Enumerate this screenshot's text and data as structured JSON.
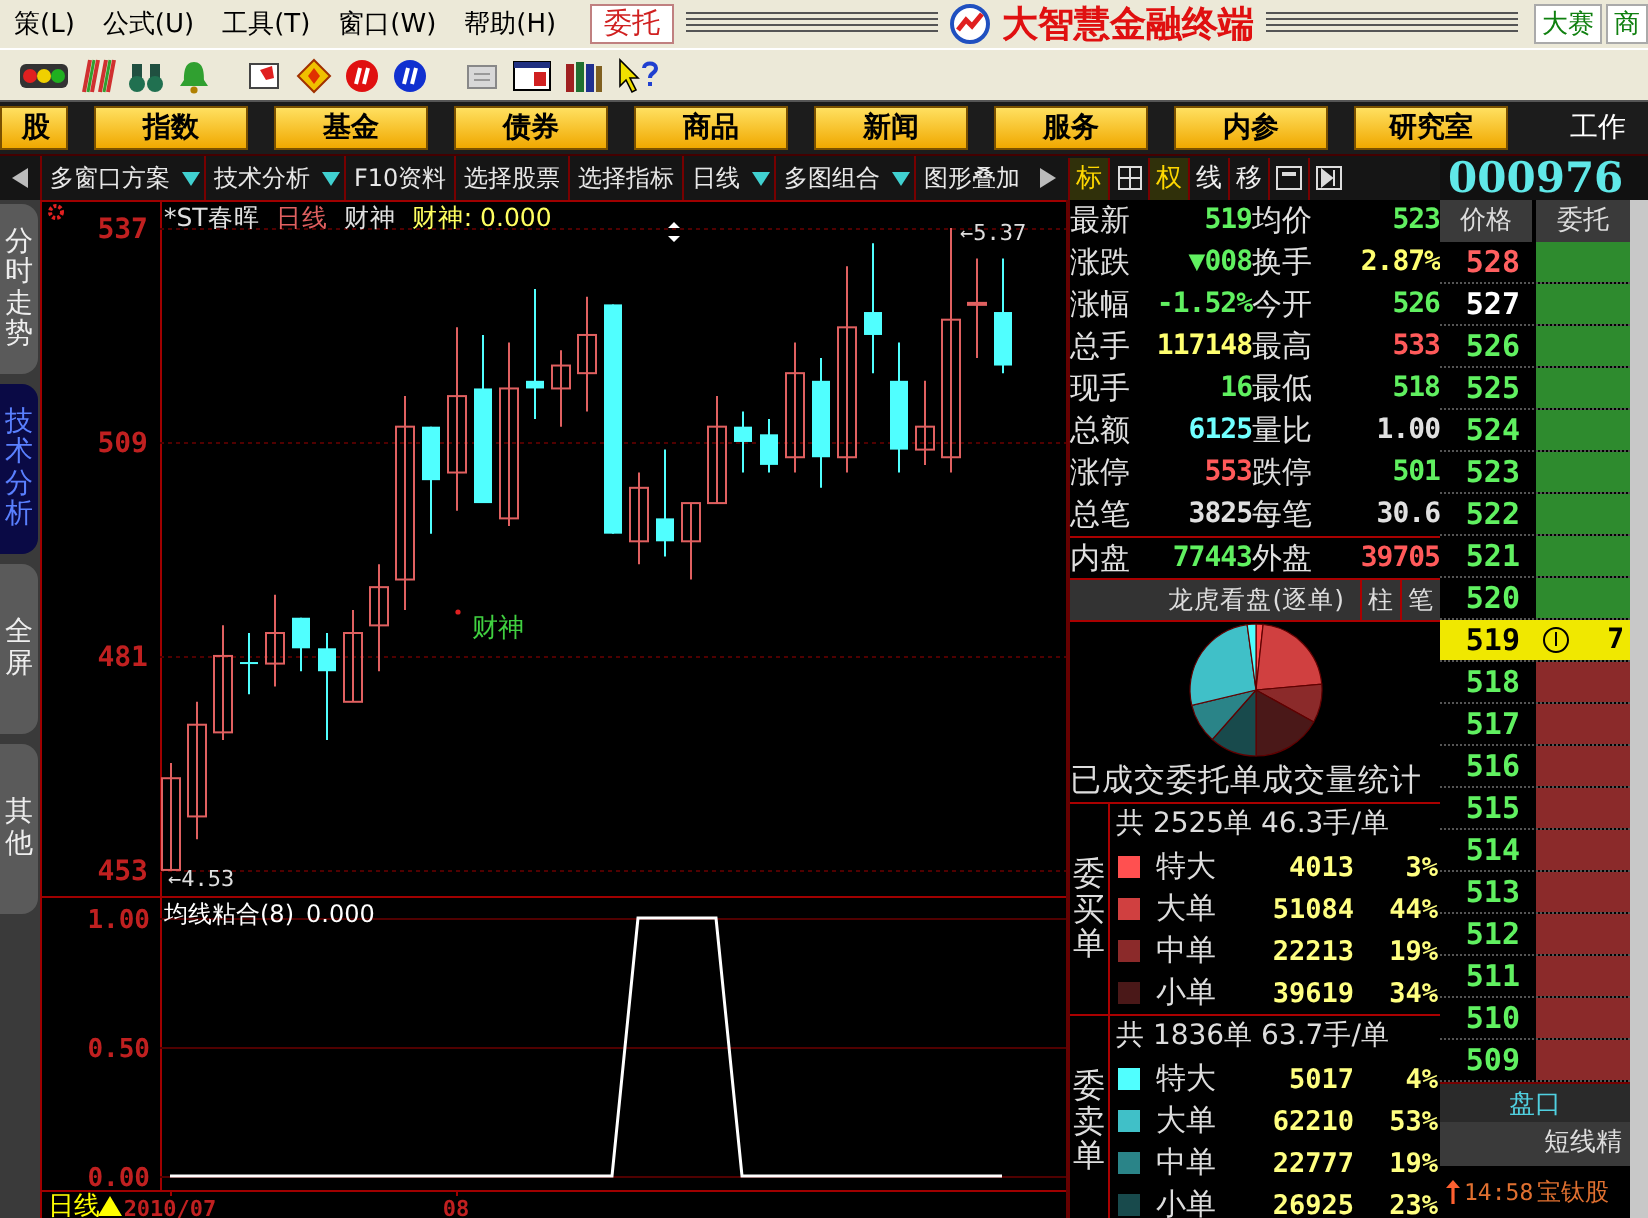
{
  "menu_bar": {
    "items": [
      "策(L)",
      "公式(U)",
      "工具(T)",
      "窗口(W)",
      "帮助(H)"
    ],
    "order_button": "委托",
    "title": "大智慧金融终端",
    "right_tabs": [
      "大赛",
      "商"
    ]
  },
  "nav_bar": {
    "buttons": [
      "股",
      "指数",
      "基金",
      "债券",
      "商品",
      "新闻",
      "服务",
      "内参",
      "研究室"
    ],
    "extra": "工作"
  },
  "tab_bar": {
    "items": [
      {
        "label": "多窗口方案",
        "dropdown": true
      },
      {
        "label": "技术分析",
        "dropdown": true
      },
      {
        "label": "F10资料",
        "dropdown": false
      },
      {
        "label": "选择股票",
        "dropdown": false
      },
      {
        "label": "选择指标",
        "dropdown": false
      },
      {
        "label": "日线",
        "dropdown": true
      },
      {
        "label": "多图组合",
        "dropdown": true
      },
      {
        "label": "图形叠加",
        "dropdown": false
      }
    ],
    "right_buttons": [
      {
        "kind": "text",
        "label": "标",
        "selected": true
      },
      {
        "kind": "grid",
        "selected": false
      },
      {
        "kind": "text",
        "label": "权",
        "selected": true
      },
      {
        "kind": "text",
        "label": "线",
        "selected": false
      },
      {
        "kind": "text",
        "label": "移",
        "selected": false
      },
      {
        "kind": "window",
        "selected": false
      },
      {
        "kind": "next",
        "selected": false
      }
    ],
    "stock_code": "000976"
  },
  "side_tabs": [
    {
      "label": "分时走势",
      "selected": false
    },
    {
      "label": "技术分析",
      "selected": true
    },
    {
      "label": "全屏",
      "selected": false
    },
    {
      "label": "其他",
      "selected": false
    }
  ],
  "main_chart": {
    "header": [
      {
        "text": "*ST春晖",
        "color": "#e0e0e0"
      },
      {
        "text": "日线",
        "color": "#e06060"
      },
      {
        "text": "财神",
        "color": "#e0e0e0"
      },
      {
        "text": "财神: 0.000",
        "color": "#ffff60"
      }
    ],
    "high_mark": "←5.37",
    "low_mark": "←4.53",
    "signal_label": "财神",
    "chart_data": {
      "type": "candlestick",
      "grid": true,
      "categories": [
        null,
        null,
        null,
        null,
        null,
        null,
        null,
        null,
        null,
        null,
        null,
        null,
        null,
        null,
        null,
        null,
        null,
        null,
        null,
        null,
        null,
        null,
        null,
        null,
        null,
        null,
        null,
        null,
        null,
        null,
        null,
        null,
        null
      ],
      "ohlc": [
        [
          453,
          467,
          453,
          465
        ],
        [
          460,
          475,
          457,
          472
        ],
        [
          471,
          485,
          470,
          481
        ],
        [
          480.2,
          484,
          476,
          480
        ],
        [
          480,
          489,
          477,
          484
        ],
        [
          486,
          486,
          479,
          482
        ],
        [
          482,
          484,
          470,
          479
        ],
        [
          475,
          487,
          475,
          484
        ],
        [
          485,
          493,
          479,
          490
        ],
        [
          491,
          515,
          487,
          511
        ],
        [
          511,
          511,
          497,
          504
        ],
        [
          505,
          524,
          500,
          515
        ],
        [
          516,
          523,
          501,
          501
        ],
        [
          499,
          522,
          498,
          516
        ],
        [
          517,
          529,
          512,
          516
        ],
        [
          516,
          521,
          511,
          519
        ],
        [
          518,
          528,
          513,
          523
        ],
        [
          527,
          527,
          497,
          497
        ],
        [
          496,
          505,
          493,
          503
        ],
        [
          499,
          508,
          494,
          496
        ],
        [
          496,
          501,
          491,
          501
        ],
        [
          501,
          515,
          501,
          511
        ],
        [
          511,
          513,
          505,
          509
        ],
        [
          510,
          512,
          505,
          506
        ],
        [
          507,
          522,
          505,
          518
        ],
        [
          517,
          520,
          503,
          507
        ],
        [
          507,
          532,
          505,
          524
        ],
        [
          526,
          535,
          518,
          523
        ],
        [
          517,
          522,
          505,
          508
        ],
        [
          508,
          517,
          506,
          511
        ],
        [
          507,
          537,
          505,
          525
        ],
        [
          527,
          533,
          520,
          527.2
        ],
        [
          526,
          533,
          518,
          519
        ]
      ],
      "ylim": [
        449.85,
        540.66
      ],
      "yticks": [
        537,
        509,
        481,
        453
      ]
    }
  },
  "indicator": {
    "value": "0.000",
    "bottom_label": "日线",
    "chart_data": {
      "type": "line",
      "grid": true,
      "categories": [
        "2010/07",
        null,
        null,
        null,
        null,
        null,
        null,
        null,
        null,
        null,
        null,
        "08",
        null,
        null,
        null,
        null,
        null,
        null,
        null,
        null,
        null,
        null,
        null,
        null,
        null,
        null,
        null,
        null,
        null,
        null,
        null,
        null,
        null
      ],
      "series": [
        {
          "name": "均线粘合(8)",
          "color": "#ffffff",
          "values": [
            0,
            0,
            0,
            0,
            0,
            0,
            0,
            0,
            0,
            0,
            0,
            0,
            0,
            0,
            0,
            0,
            0,
            0,
            1,
            1,
            1,
            1,
            0,
            0,
            0,
            0,
            0,
            0,
            0,
            0,
            0,
            0,
            0
          ]
        }
      ],
      "ylim": [
        -0.054,
        1.093
      ],
      "yticks": [
        {
          "value": 1,
          "label": "1.00"
        },
        {
          "value": 0.5,
          "label": "0.50"
        },
        {
          "value": 0,
          "label": "0.00"
        }
      ]
    }
  },
  "quotes": [
    {
      "label": "最新",
      "value": "519",
      "color": "#60f060"
    },
    {
      "label": "均价",
      "value": "523",
      "color": "#60f060"
    },
    {
      "label": "涨跌",
      "value": "▼008",
      "color": "#60f060"
    },
    {
      "label": "换手",
      "value": "2.87%",
      "color": "#ffff70"
    },
    {
      "label": "涨幅",
      "value": "-1.52%",
      "color": "#60f060"
    },
    {
      "label": "今开",
      "value": "526",
      "color": "#60f060"
    },
    {
      "label": "总手",
      "value": "117148",
      "color": "#ffff70"
    },
    {
      "label": "最高",
      "value": "533",
      "color": "#ff5a5a"
    },
    {
      "label": "现手",
      "value": "16",
      "color": "#60f060"
    },
    {
      "label": "最低",
      "value": "518",
      "color": "#60f060"
    },
    {
      "label": "总额",
      "value": "6125",
      "color": "#70ffff"
    },
    {
      "label": "量比",
      "value": "1.00",
      "color": "#e0e0e0"
    },
    {
      "label": "涨停",
      "value": "553",
      "color": "#ff5a5a"
    },
    {
      "label": "跌停",
      "value": "501",
      "color": "#60f060"
    },
    {
      "label": "总笔",
      "value": "3825",
      "color": "#e0e0e0"
    },
    {
      "label": "每笔",
      "value": "30.6",
      "color": "#e0e0e0"
    },
    {
      "label": "内盘",
      "value": "77443",
      "color": "#60f060"
    },
    {
      "label": "外盘",
      "value": "39705",
      "color": "#ff5a5a"
    }
  ],
  "dragon_tiger": {
    "title": "龙虎看盘(逐单)",
    "tabs": [
      "柱",
      "笔"
    ],
    "caption": "已成交委托单成交量统计",
    "buy": {
      "side_label": "委买单",
      "summary": "共 2525单 46.3手/单",
      "rows": [
        {
          "label": "特大",
          "volume": "4013",
          "share": "3%",
          "color": "#ff5050"
        },
        {
          "label": "大单",
          "volume": "51084",
          "share": "44%",
          "color": "#d04040"
        },
        {
          "label": "中单",
          "volume": "22213",
          "share": "19%",
          "color": "#8b2a2a"
        },
        {
          "label": "小单",
          "volume": "39619",
          "share": "34%",
          "color": "#4a1818"
        }
      ]
    },
    "sell": {
      "side_label": "委卖单",
      "summary": "共 1836单 63.7手/单",
      "rows": [
        {
          "label": "特大",
          "volume": "5017",
          "share": "4%",
          "color": "#50ffff"
        },
        {
          "label": "大单",
          "volume": "62210",
          "share": "53%",
          "color": "#40c0c8"
        },
        {
          "label": "中单",
          "volume": "22777",
          "share": "19%",
          "color": "#2a8488"
        },
        {
          "label": "小单",
          "volume": "26925",
          "share": "23%",
          "color": "#184a4c"
        }
      ]
    }
  },
  "order_book": {
    "headers": [
      "价格",
      "委托"
    ],
    "rows": [
      {
        "price": "528",
        "color": "#ff6060",
        "kind": "ask"
      },
      {
        "price": "527",
        "color": "#ffffff",
        "kind": "ask"
      },
      {
        "price": "526",
        "color": "#60f060",
        "kind": "ask"
      },
      {
        "price": "525",
        "color": "#60f060",
        "kind": "ask"
      },
      {
        "price": "524",
        "color": "#60f060",
        "kind": "ask"
      },
      {
        "price": "523",
        "color": "#60f060",
        "kind": "ask"
      },
      {
        "price": "522",
        "color": "#60f060",
        "kind": "ask"
      },
      {
        "price": "521",
        "color": "#60f060",
        "kind": "ask"
      },
      {
        "price": "520",
        "color": "#60f060",
        "kind": "ask"
      },
      {
        "price": "519",
        "color": "#000000",
        "kind": "current",
        "volume": "7"
      },
      {
        "price": "518",
        "color": "#60f060",
        "kind": "bid"
      },
      {
        "price": "517",
        "color": "#60f060",
        "kind": "bid"
      },
      {
        "price": "516",
        "color": "#60f060",
        "kind": "bid"
      },
      {
        "price": "515",
        "color": "#60f060",
        "kind": "bid"
      },
      {
        "price": "514",
        "color": "#60f060",
        "kind": "bid"
      },
      {
        "price": "513",
        "color": "#60f060",
        "kind": "bid"
      },
      {
        "price": "512",
        "color": "#60f060",
        "kind": "bid"
      },
      {
        "price": "511",
        "color": "#60f060",
        "kind": "bid"
      },
      {
        "price": "510",
        "color": "#60f060",
        "kind": "bid"
      },
      {
        "price": "509",
        "color": "#60f060",
        "kind": "bid"
      }
    ]
  },
  "footer": {
    "tab": "盘口",
    "panel_title": "短线精",
    "alert": {
      "time": "14:58",
      "name": "宝钛股"
    }
  }
}
